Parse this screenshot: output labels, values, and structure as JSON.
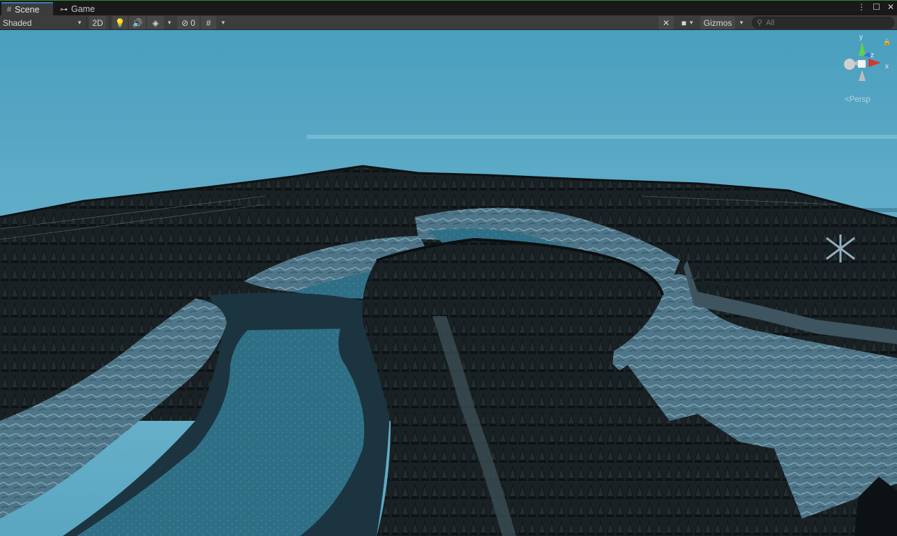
{
  "tabs": [
    {
      "label": "Scene",
      "icon": "grid-icon",
      "active": true
    },
    {
      "label": "Game",
      "icon": "gamepad-icon",
      "active": false
    }
  ],
  "window_controls": {
    "more": "⋮",
    "maximize": "☐",
    "close": "✕"
  },
  "toolbar": {
    "draw_mode": "Shaded",
    "mode_2d": "2D",
    "hidden_count": "0",
    "gizmos_label": "Gizmos",
    "search_placeholder": "All"
  },
  "gizmo": {
    "y_label": "y",
    "z_label": "z",
    "x_label": "x",
    "projection": "Persp"
  },
  "colors": {
    "toolbar_bg": "#3c3c3c",
    "tab_accent": "#3a79bb",
    "sky_top": "#4aa0bf",
    "water": "#2f6f86"
  }
}
